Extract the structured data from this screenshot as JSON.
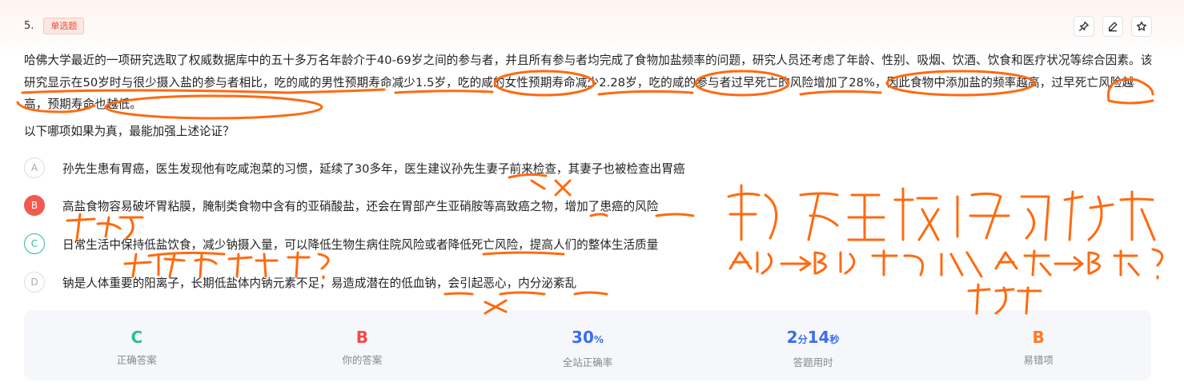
{
  "question": {
    "number": "5.",
    "type_tag": "单选题",
    "stem": "哈佛大学最近的一项研究选取了权威数据库中的五十多万名年龄介于40-69岁之间的参与者，并且所有参与者均完成了食物加盐频率的问题，研究人员还考虑了年龄、性别、吸烟、饮酒、饮食和医疗状况等综合因素。该研究显示在50岁时与很少摄入盐的参与者相比，吃的咸的男性预期寿命减少1.5岁，吃的咸的女性预期寿命减少2.28岁，吃的咸的参与者过早死亡的风险增加了28%，因此食物中添加盐的频率越高，过早死亡风险越高，预期寿命也越低。",
    "prompt": "以下哪项如果为真，最能加强上述论证？"
  },
  "toolbar": {
    "icons": [
      "pin-icon",
      "edit-icon",
      "star-icon"
    ]
  },
  "options": [
    {
      "letter": "A",
      "text": "孙先生患有胃癌，医生发现他有吃咸泡菜的习惯，延续了30多年，医生建议孙先生妻子前来检查，其妻子也被检查出胃癌",
      "state": "normal"
    },
    {
      "letter": "B",
      "text": "高盐食物容易破坏胃粘膜，腌制类食物中含有的亚硝酸盐，还会在胃部产生亚硝胺等高致癌之物，增加了患癌的风险",
      "state": "selected-wrong"
    },
    {
      "letter": "C",
      "text": "日常生活中保持低盐饮食，减少钠摄入量，可以降低生物生病住院风险或者降低死亡风险，提高人们的整体生活质量",
      "state": "correct"
    },
    {
      "letter": "D",
      "text": "钠是人体重要的阳离子，长期低盐体内钠元素不足，易造成潜在的低血钠，会引起恶心，内分泌紊乱",
      "state": "normal"
    }
  ],
  "stats": [
    {
      "value": "C",
      "unit": "",
      "label": "正确答案",
      "color": "#2cbd98"
    },
    {
      "value": "B",
      "unit": "",
      "label": "你的答案",
      "color": "#f24a4a"
    },
    {
      "value": "30",
      "unit": "%",
      "label": "全站正确率",
      "color": "#3a6df0"
    },
    {
      "value": "2",
      "unit": "分",
      "value2": "14",
      "unit2": "秒",
      "label": "答题用时",
      "color": "#3a6df0"
    },
    {
      "value": "B",
      "unit": "",
      "label": "易错项",
      "color": "#ff7a26"
    }
  ],
  "handwriting": {
    "note1": "癌不直接代表死亡风险，寿命",
    "note2": "A少→B少 可以证明 A高→B高吗？",
    "note3": "不定啊",
    "note4": "可以降低吗？",
    "note5": "不改吧"
  }
}
